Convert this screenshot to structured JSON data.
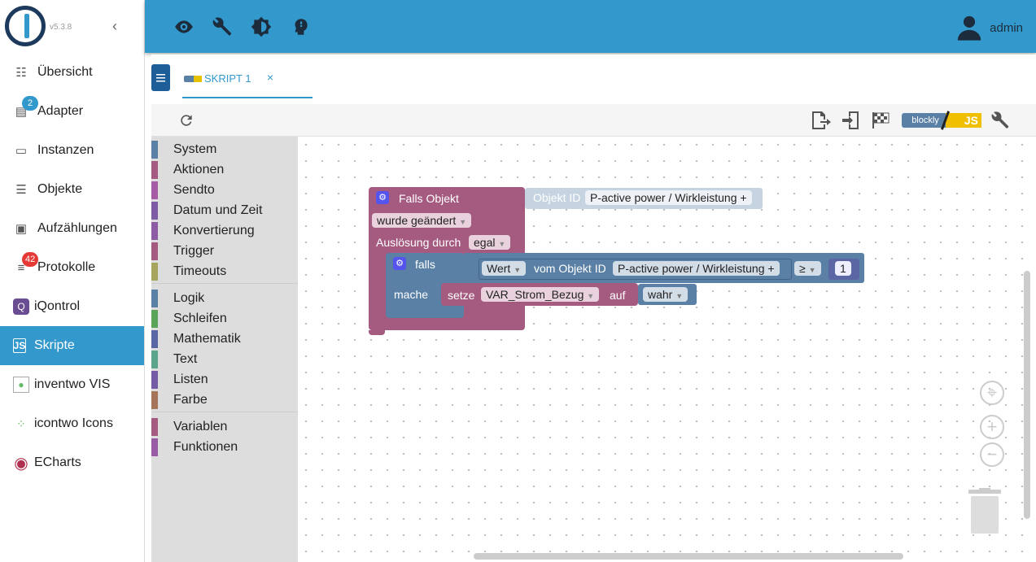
{
  "app": {
    "version": "v5.3.8"
  },
  "header": {
    "user": "admin",
    "icons": [
      "eye-icon",
      "wrench-icon",
      "brightness-icon",
      "head-icon"
    ]
  },
  "sidebar": {
    "items": [
      {
        "label": "Übersicht",
        "icon": "grid-icon"
      },
      {
        "label": "Adapter",
        "icon": "store-icon",
        "badge": "2"
      },
      {
        "label": "Instanzen",
        "icon": "instances-icon"
      },
      {
        "label": "Objekte",
        "icon": "list-icon"
      },
      {
        "label": "Aufzählungen",
        "icon": "enum-icon"
      },
      {
        "label": "Protokolle",
        "icon": "log-icon",
        "badge": "42"
      },
      {
        "label": "iQontrol",
        "icon": "iqontrol-icon"
      },
      {
        "label": "Skripte",
        "icon": "js-icon",
        "active": true
      },
      {
        "label": "inventwo VIS",
        "icon": "inventwo-icon"
      },
      {
        "label": "icontwo Icons",
        "icon": "icontwo-icon"
      },
      {
        "label": "ECharts",
        "icon": "echarts-icon"
      }
    ]
  },
  "tabs": [
    {
      "label": "SKRIPT 1",
      "close": "×"
    }
  ],
  "toolbar": {
    "blockly_label": "blockly",
    "js_label": "JS"
  },
  "categories": {
    "group1": [
      {
        "label": "System",
        "color": "#5b80a5"
      },
      {
        "label": "Aktionen",
        "color": "#a55b80"
      },
      {
        "label": "Sendto",
        "color": "#a55ba5"
      },
      {
        "label": "Datum und Zeit",
        "color": "#805ba5"
      },
      {
        "label": "Konvertierung",
        "color": "#8e5ba5"
      },
      {
        "label": "Trigger",
        "color": "#a55b80"
      },
      {
        "label": "Timeouts",
        "color": "#a5a55b"
      }
    ],
    "group2": [
      {
        "label": "Logik",
        "color": "#5b80a5"
      },
      {
        "label": "Schleifen",
        "color": "#5ba55b"
      },
      {
        "label": "Mathematik",
        "color": "#5b67a5"
      },
      {
        "label": "Text",
        "color": "#5ba58c"
      },
      {
        "label": "Listen",
        "color": "#745ba5"
      },
      {
        "label": "Farbe",
        "color": "#a5745b"
      }
    ],
    "group3": [
      {
        "label": "Variablen",
        "color": "#a55b80"
      },
      {
        "label": "Funktionen",
        "color": "#995ba5"
      }
    ]
  },
  "blocks": {
    "trigger": {
      "title": "Falls Objekt",
      "event": "wurde geändert",
      "source_label": "Auslösung durch",
      "source_value": "egal"
    },
    "object_id": {
      "label": "Objekt ID",
      "value": "P-active power / Wirkleistung +"
    },
    "if_block": {
      "label": "falls",
      "do_label": "mache"
    },
    "condition": {
      "attr": "Wert",
      "of_label": "vom Objekt ID",
      "object": "P-active power / Wirkleistung +",
      "operator": "≥",
      "number": "1"
    },
    "set_var": {
      "label": "setze",
      "variable": "VAR_Strom_Bezug",
      "to_label": "auf",
      "value": "wahr"
    }
  },
  "colors": {
    "accent": "#3399cc",
    "trigger": "#a55b80",
    "logic": "#5b80a5",
    "sidebar_active": "#3399cc"
  }
}
